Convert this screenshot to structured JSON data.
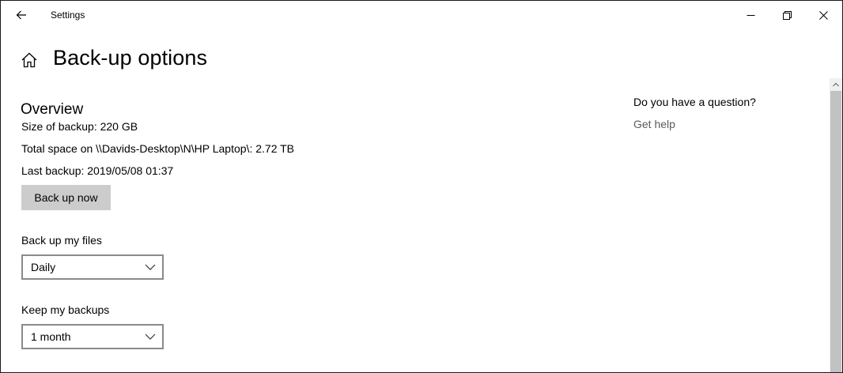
{
  "window": {
    "title": "Settings"
  },
  "header": {
    "page_title": "Back-up options"
  },
  "overview": {
    "title": "Overview",
    "size_of_backup": "Size of backup: 220 GB",
    "total_space": "Total space on \\\\Davids-Desktop\\N\\HP Laptop\\: 2.72 TB",
    "last_backup": "Last backup: 2019/05/08 01:37",
    "back_up_now_label": "Back up now"
  },
  "backup_frequency": {
    "label": "Back up my files",
    "selected": "Daily"
  },
  "keep_backups": {
    "label": "Keep my backups",
    "selected": "1 month"
  },
  "side_panel": {
    "question": "Do you have a question?",
    "help_link": "Get help"
  },
  "icons": {
    "back": "back-arrow-icon",
    "home": "home-icon",
    "minimize": "minimize-icon",
    "maximize": "restore-icon",
    "close": "close-icon",
    "chevron": "chevron-down-icon"
  }
}
